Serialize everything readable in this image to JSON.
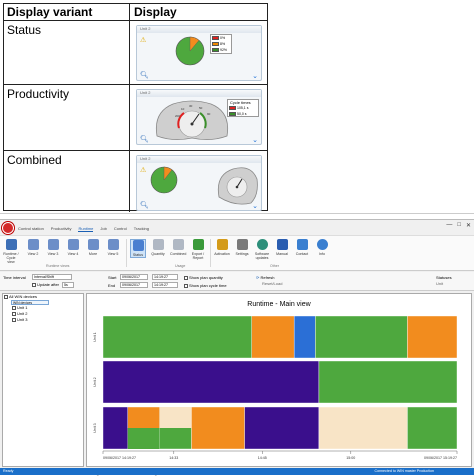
{
  "table": {
    "headers": [
      "Display variant",
      "Display"
    ],
    "rows": [
      {
        "variant": "Status",
        "widget_title": "Unit 2"
      },
      {
        "variant": "Productivity",
        "widget_title": "Unit 2"
      },
      {
        "variant": "Combined",
        "widget_title": "Unit 2"
      }
    ],
    "status_legend": [
      {
        "color": "#e02020",
        "label": "0%"
      },
      {
        "color": "#f08a00",
        "label": "8%"
      },
      {
        "color": "#3a8f2a",
        "label": "92%"
      }
    ],
    "cycle_times": {
      "title": "Cycle times",
      "entries": [
        {
          "color": "#e02020",
          "label": "105,1 s"
        },
        {
          "color": "#3a8f2a",
          "label": "50,0 s"
        }
      ]
    },
    "gauge_labels": [
      "10",
      "15",
      "20",
      "25",
      "30",
      "35",
      "40",
      "45",
      "50",
      "55",
      "60",
      "70",
      "80",
      "90",
      "100",
      "125",
      "150",
      "200",
      "300",
      "1000"
    ]
  },
  "app": {
    "menu": [
      "Control station",
      "Productivity",
      "Runtime",
      "Job",
      "Control",
      "Tracking"
    ],
    "active_menu": "Runtime",
    "window_controls": [
      "—",
      "□",
      "✕"
    ],
    "ribbon": {
      "buttons": [
        {
          "label": "Runtime / Cycle view",
          "color": "#3d6fb6"
        },
        {
          "label": "View 2",
          "color": "#6c8ec8"
        },
        {
          "label": "View 3",
          "color": "#6c8ec8"
        },
        {
          "label": "View 4",
          "color": "#6c8ec8"
        },
        {
          "label": "More",
          "color": "#6c8ec8"
        },
        {
          "label": "View 5",
          "color": "#6c8ec8"
        },
        {
          "label": "Status",
          "color": "#4a7fd0"
        },
        {
          "label": "Quantity",
          "color": "#b0b8c4"
        },
        {
          "label": "Combined",
          "color": "#b0b8c4"
        },
        {
          "label": "Export / Report",
          "color": "#3a9a3a"
        },
        {
          "label": "Activation",
          "color": "#d49b1a"
        },
        {
          "label": "Settings",
          "color": "#7a7a7a"
        },
        {
          "label": "Software updates",
          "color": "#2d8f7a"
        },
        {
          "label": "Manual",
          "color": "#2a5db0"
        },
        {
          "label": "Contact",
          "color": "#3a7fd0"
        },
        {
          "label": "Info",
          "color": "#3a7fd0"
        }
      ],
      "groups": [
        "Runtime views",
        "Usage",
        "Other"
      ]
    },
    "filter": {
      "time_interval_label": "Time interval",
      "time_interval_value": "Interval/Shift",
      "update_label": "Update after",
      "update_value": "5s",
      "start_label": "Start",
      "start_date": "09/06/2017",
      "start_time": "14:19:27",
      "end_label": "End",
      "end_date": "09/06/2017",
      "end_time": "14:19:27",
      "plan_quantity": "Show plan quantity",
      "plan_cycle": "Show plan cycle time",
      "refresh": "Refresh",
      "refresh_sub": "Reset/Load",
      "statuses": "Statuses",
      "statuses_sub": "Unit"
    },
    "tree": {
      "root": "All WIN devices",
      "sub": "WIN devices",
      "units": [
        "Unit 1",
        "Unit 2",
        "Unit 3"
      ]
    },
    "chart_title": "Runtime - Main view",
    "bottom": {
      "interval_label": "Interval / Interval",
      "interval_sub": "Change time interval",
      "zoom_label": "Zoom out | Zoom in",
      "zoom_sub": "Change time interval"
    },
    "status_bar": {
      "left": "Ready",
      "right": "Connected to WIN master Production"
    }
  },
  "chart_data": {
    "type": "gantt",
    "categories": [
      "Unit 1",
      "Unit 2",
      "Unit 3"
    ],
    "x_ticks": [
      "09/06/2017 14:19:27",
      "14:33",
      "14:45",
      "15:00",
      "09/06/2017 15:19:27"
    ],
    "colors": {
      "green": "#4ea83e",
      "orange": "#f28c1e",
      "blue": "#2b6fd6",
      "purple": "#3a0f8c",
      "cream": "#f8e4c6"
    },
    "series": [
      {
        "row": 0,
        "segments": [
          [
            0.0,
            0.42,
            "green"
          ],
          [
            0.42,
            0.54,
            "orange"
          ],
          [
            0.54,
            0.6,
            "blue"
          ],
          [
            0.6,
            0.86,
            "green"
          ],
          [
            0.86,
            1.0,
            "orange"
          ]
        ]
      },
      {
        "row": 1,
        "segments": [
          [
            0.0,
            0.61,
            "purple"
          ],
          [
            0.61,
            1.0,
            "green"
          ]
        ]
      },
      {
        "row": 2,
        "segments": [
          [
            0.0,
            0.07,
            "purple"
          ],
          [
            0.07,
            0.16,
            "orange"
          ],
          [
            0.16,
            0.25,
            "green"
          ],
          [
            0.25,
            0.4,
            "orange"
          ],
          [
            0.4,
            0.61,
            "purple"
          ],
          [
            0.61,
            0.86,
            "cream"
          ],
          [
            0.86,
            1.0,
            "green"
          ]
        ]
      }
    ]
  }
}
